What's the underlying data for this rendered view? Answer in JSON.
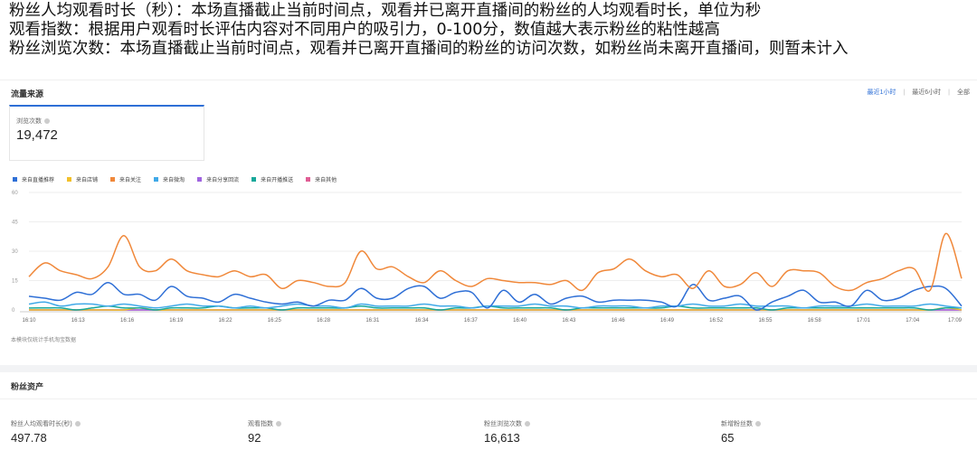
{
  "intro": {
    "line1": "粉丝人均观看时长（秒）：本场直播截止当前时间点，观看并已离开直播间的粉丝的人均观看时长，单位为秒",
    "line2": "观看指数：根据用户观看时长评估内容对不同用户的吸引力，0-100分，数值越大表示粉丝的粘性越高",
    "line3": "粉丝浏览次数：本场直播截止当前时间点，观看并已离开直播间的粉丝的访问次数，如粉丝尚未离开直播间，则暂未计入"
  },
  "traffic": {
    "title": "流量来源",
    "range": {
      "opt1": "最近1小时",
      "sep1": "|",
      "opt2": "最近6小时",
      "sep2": "|",
      "opt3": "全部"
    },
    "card": {
      "label": "浏览次数",
      "value": "19,472"
    },
    "note": "本模块仅统计手机淘宝数据"
  },
  "chart_data": {
    "type": "line",
    "yticks": [
      "60",
      "45",
      "30",
      "15",
      "0"
    ],
    "ylim": [
      0,
      60
    ],
    "xticks": [
      "16:10",
      "16:13",
      "16:16",
      "16:19",
      "16:22",
      "16:25",
      "16:28",
      "16:31",
      "16:34",
      "16:37",
      "16:40",
      "16:43",
      "16:46",
      "16:49",
      "16:52",
      "16:55",
      "16:58",
      "17:01",
      "17:04",
      "17:09"
    ],
    "grid": true,
    "legend_position": "top-left",
    "series": [
      {
        "name": "来自直播推荐",
        "color": "#2e6fd6",
        "values": [
          7,
          6,
          5,
          9,
          8,
          14,
          8,
          8,
          5,
          12,
          7,
          6,
          4,
          8,
          6,
          4,
          3,
          4,
          2,
          5,
          5,
          11,
          6,
          6,
          11,
          12,
          6,
          9,
          9,
          1,
          10,
          4,
          8,
          3,
          6,
          7,
          4,
          5,
          5,
          5,
          4,
          2,
          13,
          5,
          6,
          7,
          0,
          4,
          7,
          10,
          4,
          4,
          2,
          10,
          5,
          6,
          10,
          12,
          11,
          2
        ]
      },
      {
        "name": "来自店铺",
        "color": "#f2c02a",
        "values": [
          0,
          0,
          0,
          0,
          0,
          0,
          0,
          1,
          0,
          0,
          0,
          0,
          0,
          0,
          0,
          0,
          0,
          0,
          0,
          0,
          0,
          0,
          0,
          0,
          0,
          0,
          0,
          0,
          0,
          0,
          0,
          0,
          0,
          0,
          0,
          0,
          0,
          0,
          0,
          0,
          0,
          0,
          0,
          0,
          0,
          0,
          0,
          0,
          0,
          0,
          0,
          0,
          0,
          0,
          0,
          0,
          0,
          0,
          1,
          0
        ]
      },
      {
        "name": "来自关注",
        "color": "#f0883a",
        "values": [
          17,
          24,
          20,
          18,
          16,
          22,
          38,
          22,
          20,
          26,
          20,
          18,
          17,
          20,
          17,
          18,
          11,
          15,
          14,
          12,
          14,
          30,
          21,
          22,
          17,
          14,
          20,
          15,
          12,
          16,
          15,
          14,
          14,
          13,
          15,
          10,
          19,
          21,
          26,
          20,
          17,
          18,
          11,
          20,
          12,
          13,
          19,
          12,
          20,
          20,
          19,
          12,
          10,
          14,
          16,
          20,
          21,
          10,
          39,
          16
        ]
      },
      {
        "name": "来自微淘",
        "color": "#40a9e8",
        "values": [
          3,
          4,
          2,
          3,
          3,
          2,
          3,
          2,
          1,
          2,
          3,
          2,
          2,
          1,
          2,
          1,
          2,
          3,
          2,
          2,
          1,
          3,
          2,
          2,
          2,
          3,
          2,
          2,
          1,
          2,
          2,
          2,
          3,
          2,
          2,
          1,
          2,
          2,
          2,
          1,
          2,
          2,
          3,
          2,
          2,
          3,
          2,
          2,
          2,
          1,
          2,
          2,
          2,
          3,
          2,
          2,
          2,
          3,
          2,
          1
        ]
      },
      {
        "name": "来自分享回流",
        "color": "#a064e0",
        "values": [
          0,
          0,
          0,
          0,
          0,
          0,
          0,
          0,
          0,
          0,
          0,
          0,
          0,
          0,
          0,
          0,
          0,
          0,
          0,
          0,
          0,
          0,
          0,
          0,
          0,
          0,
          0,
          0,
          0,
          0,
          0,
          0,
          0,
          0,
          0,
          0,
          0,
          0,
          0,
          0,
          0,
          0,
          0,
          0,
          0,
          0,
          0,
          0,
          0,
          0,
          0,
          0,
          0,
          0,
          0,
          0,
          0,
          0,
          0,
          0
        ]
      },
      {
        "name": "来自开播推送",
        "color": "#18a89a",
        "values": [
          1,
          1,
          1,
          0,
          1,
          2,
          1,
          1,
          0,
          1,
          1,
          1,
          2,
          1,
          1,
          1,
          0,
          1,
          1,
          1,
          1,
          2,
          1,
          1,
          1,
          1,
          0,
          1,
          1,
          2,
          1,
          1,
          1,
          1,
          0,
          1,
          1,
          1,
          1,
          1,
          1,
          2,
          1,
          1,
          1,
          1,
          1,
          0,
          1,
          1,
          1,
          1,
          1,
          1,
          1,
          1,
          1,
          0,
          1,
          1
        ]
      },
      {
        "name": "来自其他",
        "color": "#e05d94",
        "values": [
          0,
          0,
          0,
          0,
          0,
          0,
          0,
          0,
          0,
          0,
          0,
          0,
          0,
          0,
          0,
          0,
          0,
          0,
          0,
          0,
          0,
          0,
          0,
          0,
          0,
          0,
          0,
          0,
          0,
          0,
          0,
          0,
          0,
          0,
          0,
          0,
          0,
          0,
          0,
          0,
          0,
          0,
          0,
          0,
          0,
          0,
          0,
          0,
          0,
          0,
          0,
          0,
          0,
          0,
          0,
          0,
          0,
          0,
          0,
          0
        ]
      }
    ]
  },
  "fans": {
    "title": "粉丝资产",
    "stats": [
      {
        "label": "粉丝人均观看时长(秒)",
        "value": "497.78"
      },
      {
        "label": "观看指数",
        "value": "92"
      },
      {
        "label": "粉丝浏览次数",
        "value": "16,613"
      },
      {
        "label": "新增粉丝数",
        "value": "65"
      }
    ]
  }
}
